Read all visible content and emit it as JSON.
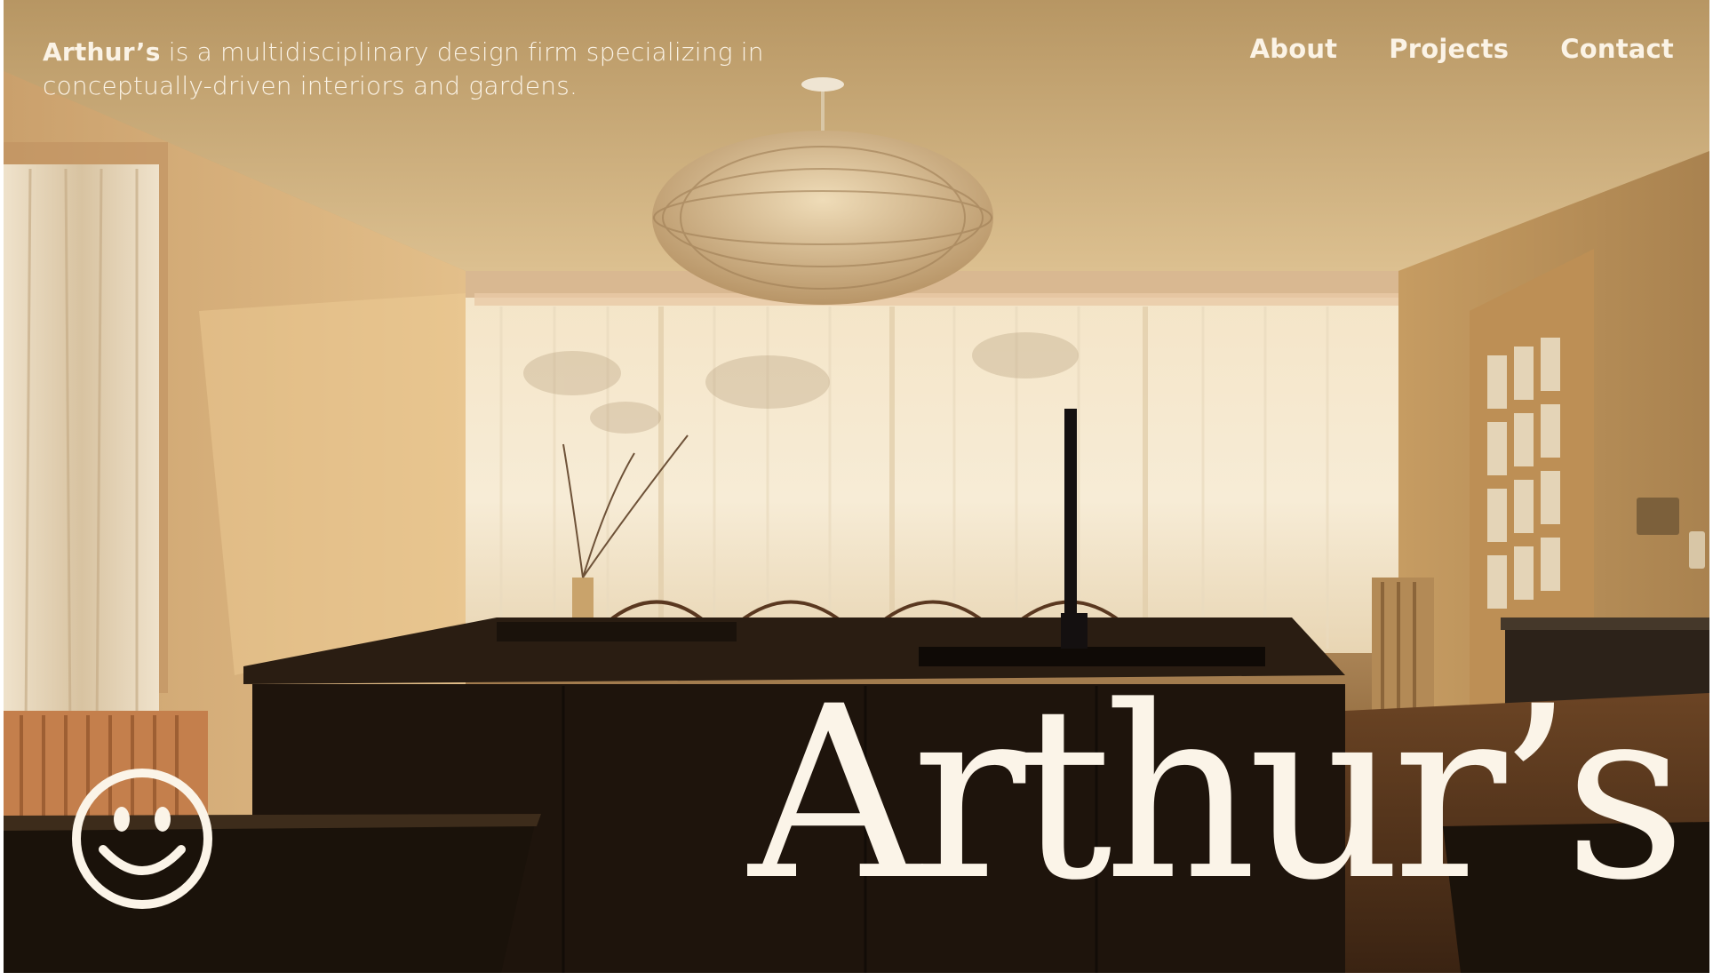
{
  "header": {
    "brand": "Arthur’s",
    "tagline_rest": " is a multidisciplinary design firm specializing in conceptually-driven interiors and gardens."
  },
  "nav": {
    "items": [
      {
        "label": "About"
      },
      {
        "label": "Projects"
      },
      {
        "label": "Contact"
      }
    ]
  },
  "hero": {
    "wordmark": "Arthur’s",
    "logo_icon": "smiley-face-icon"
  },
  "colors": {
    "text_light": "#fbf3e6",
    "wall_warm": "#d6b47f",
    "cabinet_dark": "#1e140c"
  }
}
